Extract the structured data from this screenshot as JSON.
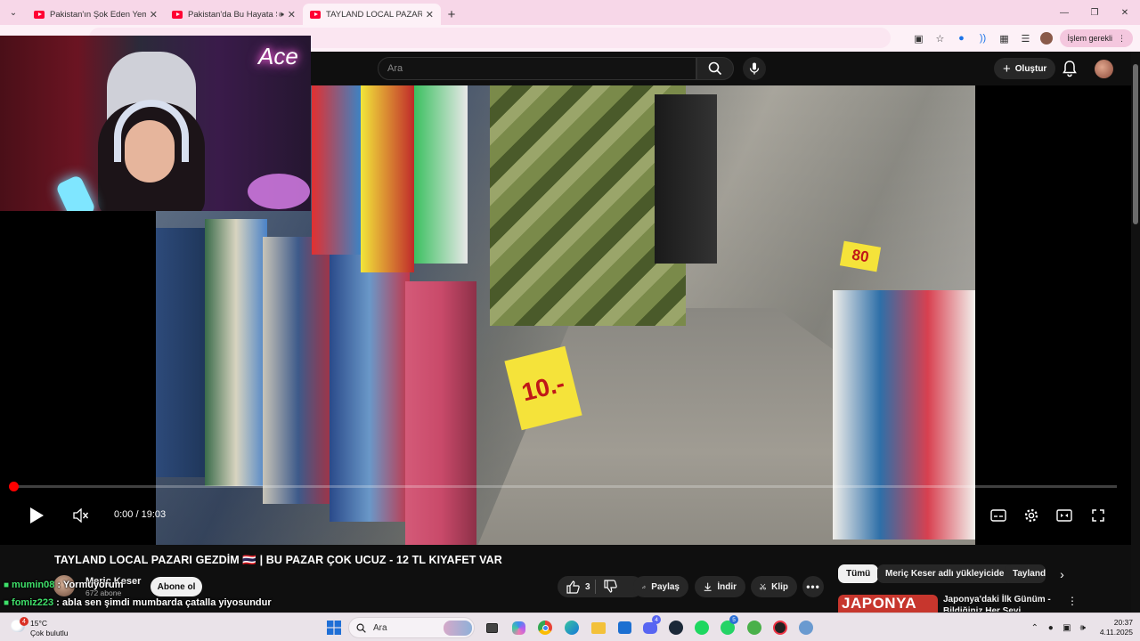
{
  "browser": {
    "tabs": [
      {
        "title": "Pakistan'ın Şok Eden Yemek Pa",
        "active": false,
        "audio": false
      },
      {
        "title": "Pakistan'da Bu Hayata Şok",
        "active": false,
        "audio": true
      },
      {
        "title": "TAYLAND LOCAL PAZARI GEZD",
        "active": true,
        "audio": false
      }
    ],
    "profile_button": "İşlem gerekli"
  },
  "youtube": {
    "search_placeholder": "Ara",
    "create_label": "Oluştur",
    "player": {
      "time_display": "0:00 / 19:03",
      "progress_fraction": 0.0,
      "state": "paused",
      "muted": true
    },
    "video": {
      "title": "TAYLAND LOCAL PAZARI GEZDİM 🇹🇭 | BU PAZAR ÇOK UCUZ - 12 TL KIYAFET VAR",
      "channel_name": "Meriç Keser",
      "subscribers": "672 abone",
      "subscribe_label": "Abone ol",
      "likes": "3",
      "share_label": "Paylaş",
      "download_label": "İndir",
      "clip_label": "Klip"
    },
    "sidebar": {
      "chips": [
        "Tümü",
        "Meriç Keser adlı yükleyiciden",
        "Tayland"
      ],
      "recommendation": {
        "thumb_text": "JAPONYA",
        "title": "Japonya'daki İlk Günüm - Bildiğiniz Her Şeyi UNUTUN!!!"
      }
    },
    "video_scene": {
      "sign_price_1": "10.-",
      "sign_price_2": "80",
      "neon_sign": "Ace"
    }
  },
  "stream_chat": [
    {
      "user": "mumin08",
      "message": "Yormuyorum"
    },
    {
      "user": "fomiz223",
      "message": "abla sen şimdi mumbarda çatalla yiyosundur"
    }
  ],
  "taskbar": {
    "weather_temp": "15°C",
    "weather_desc": "Çok bulutlu",
    "weather_badge": "4",
    "search_label": "Ara",
    "discord_badge": "4",
    "whatsapp_badge": "5",
    "time": "20:37",
    "date": "4.11.2025"
  },
  "colors": {
    "yt_red": "#ff0000",
    "chrome_tab_bg": "#f7d7e8",
    "chat_user": "#3fe06a"
  }
}
